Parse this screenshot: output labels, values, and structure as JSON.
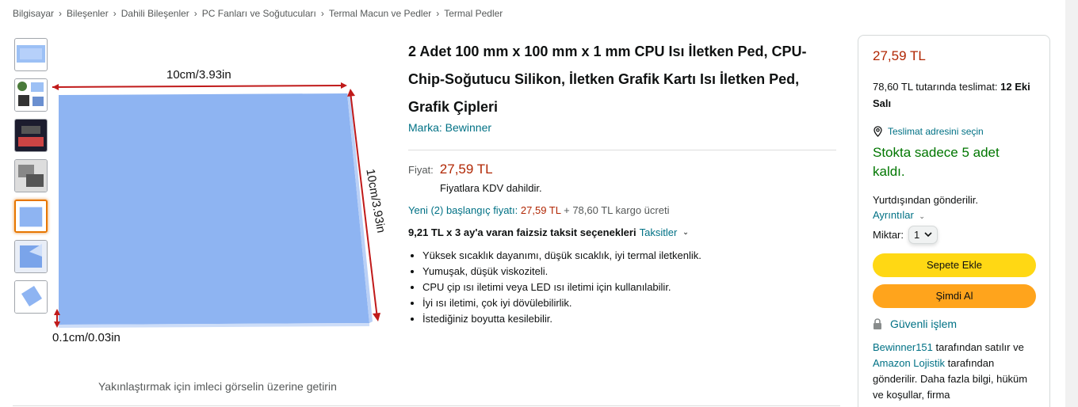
{
  "breadcrumb": {
    "items": [
      "Bilgisayar",
      "Bileşenler",
      "Dahili Bileşenler",
      "PC Fanları ve Soğutucuları",
      "Termal Macun ve Pedler",
      "Termal Pedler"
    ],
    "separator": "›"
  },
  "gallery": {
    "thumbnail_count": 7,
    "active_index": 4,
    "image_labels": {
      "width": "10cm/3.93in",
      "height": "10cm/3.93in",
      "thickness": "0.1cm/0.03in"
    },
    "zoom_hint": "Yakınlaştırmak için imleci görselin üzerine getirin"
  },
  "product": {
    "title_lines": [
      "2 Adet 100 mm x 100 mm x 1 mm CPU Isı İletken Ped, CPU-",
      "Chip-Soğutucu Silikon, İletken Grafik Kartı Isı İletken Ped,",
      "Grafik Çipleri"
    ],
    "brand": "Marka: Bewinner",
    "price_label": "Fiyat:",
    "price": "27,59 TL",
    "vat_note": "Fiyatlara KDV dahildir.",
    "new_from_link": "Yeni (2) başlangıç fiyatı:",
    "new_from_price": "27,59 TL",
    "new_from_shipping": "+ 78,60 TL kargo ücreti",
    "installment_text": "9,21 TL x 3 ay'a varan faizsiz taksit seçenekleri",
    "installment_link": "Taksitler",
    "bullets": [
      "Yüksek sıcaklık dayanımı, düşük sıcaklık, iyi termal iletkenlik.",
      "Yumuşak, düşük viskoziteli.",
      "CPU çip ısı iletimi veya LED ısı iletimi için kullanılabilir.",
      "İyi ısı iletimi, çok iyi dövülebilirlik.",
      "İstediğiniz boyutta kesilebilir."
    ]
  },
  "buybox": {
    "price": "27,59 TL",
    "delivery_prefix": "78,60 TL tutarında teslimat:",
    "delivery_date": "12 Eki Salı",
    "location_link": "Teslimat adresini seçin",
    "stock": "Stokta sadece 5 adet kaldı.",
    "ships_from": "Yurtdışından gönderilir.",
    "details_link": "Ayrıntılar",
    "qty_label": "Miktar:",
    "qty_value": "1",
    "add_to_cart": "Sepete Ekle",
    "buy_now": "Şimdi Al",
    "secure": "Güvenli işlem",
    "seller_name": "Bewinner151",
    "seller_mid": "tarafından satılır ve",
    "fulfiller": "Amazon Lojistik",
    "seller_tail": "tarafından gönderilir. Daha fazla bilgi, hüküm ve koşullar, firma"
  },
  "colors": {
    "price_red": "#B12704",
    "link_teal": "#007185",
    "stock_green": "#007600",
    "cart_yellow": "#FFD814",
    "buy_orange": "#FFA41C",
    "pad_blue": "#8EB4F2"
  }
}
